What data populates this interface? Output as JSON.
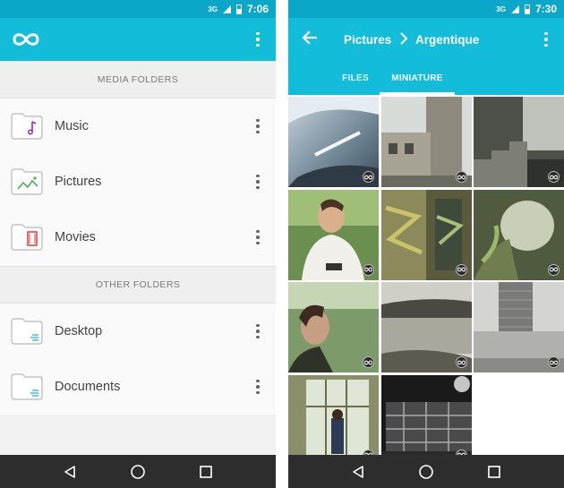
{
  "left": {
    "status": {
      "network": "3G",
      "time": "7:06"
    },
    "sections": [
      {
        "title": "MEDIA FOLDERS"
      },
      {
        "title": "OTHER FOLDERS"
      }
    ],
    "folders": [
      {
        "label": "Music",
        "icon": "music-folder-icon",
        "accent": "#9c27b0"
      },
      {
        "label": "Pictures",
        "icon": "pictures-folder-icon",
        "accent": "#4caf50"
      },
      {
        "label": "Movies",
        "icon": "movies-folder-icon",
        "accent": "#e53935"
      },
      {
        "label": "Desktop",
        "icon": "desktop-folder-icon",
        "accent": "#29b6d8"
      },
      {
        "label": "Documents",
        "icon": "documents-folder-icon",
        "accent": "#29b6d8"
      }
    ]
  },
  "right": {
    "status": {
      "network": "3G",
      "time": "7:30"
    },
    "breadcrumb": {
      "parent": "Pictures",
      "current": "Argentique"
    },
    "tabs": [
      {
        "label": "FILES",
        "active": false
      },
      {
        "label": "MINIATURE",
        "active": true
      }
    ],
    "thumbnails": [
      {
        "name": "vespa-photo"
      },
      {
        "name": "building-photo"
      },
      {
        "name": "stairs-photo"
      },
      {
        "name": "man-smartphone-photo"
      },
      {
        "name": "graffiti-photo"
      },
      {
        "name": "tunnel-graffiti-photo"
      },
      {
        "name": "woman-profile-photo"
      },
      {
        "name": "lake-photo"
      },
      {
        "name": "tower-photo"
      },
      {
        "name": "window-person-photo"
      },
      {
        "name": "night-building-photo"
      }
    ]
  },
  "colors": {
    "primary": "#13bcd9",
    "status": "#0aa7c8",
    "navbar": "#2d2d2d"
  }
}
